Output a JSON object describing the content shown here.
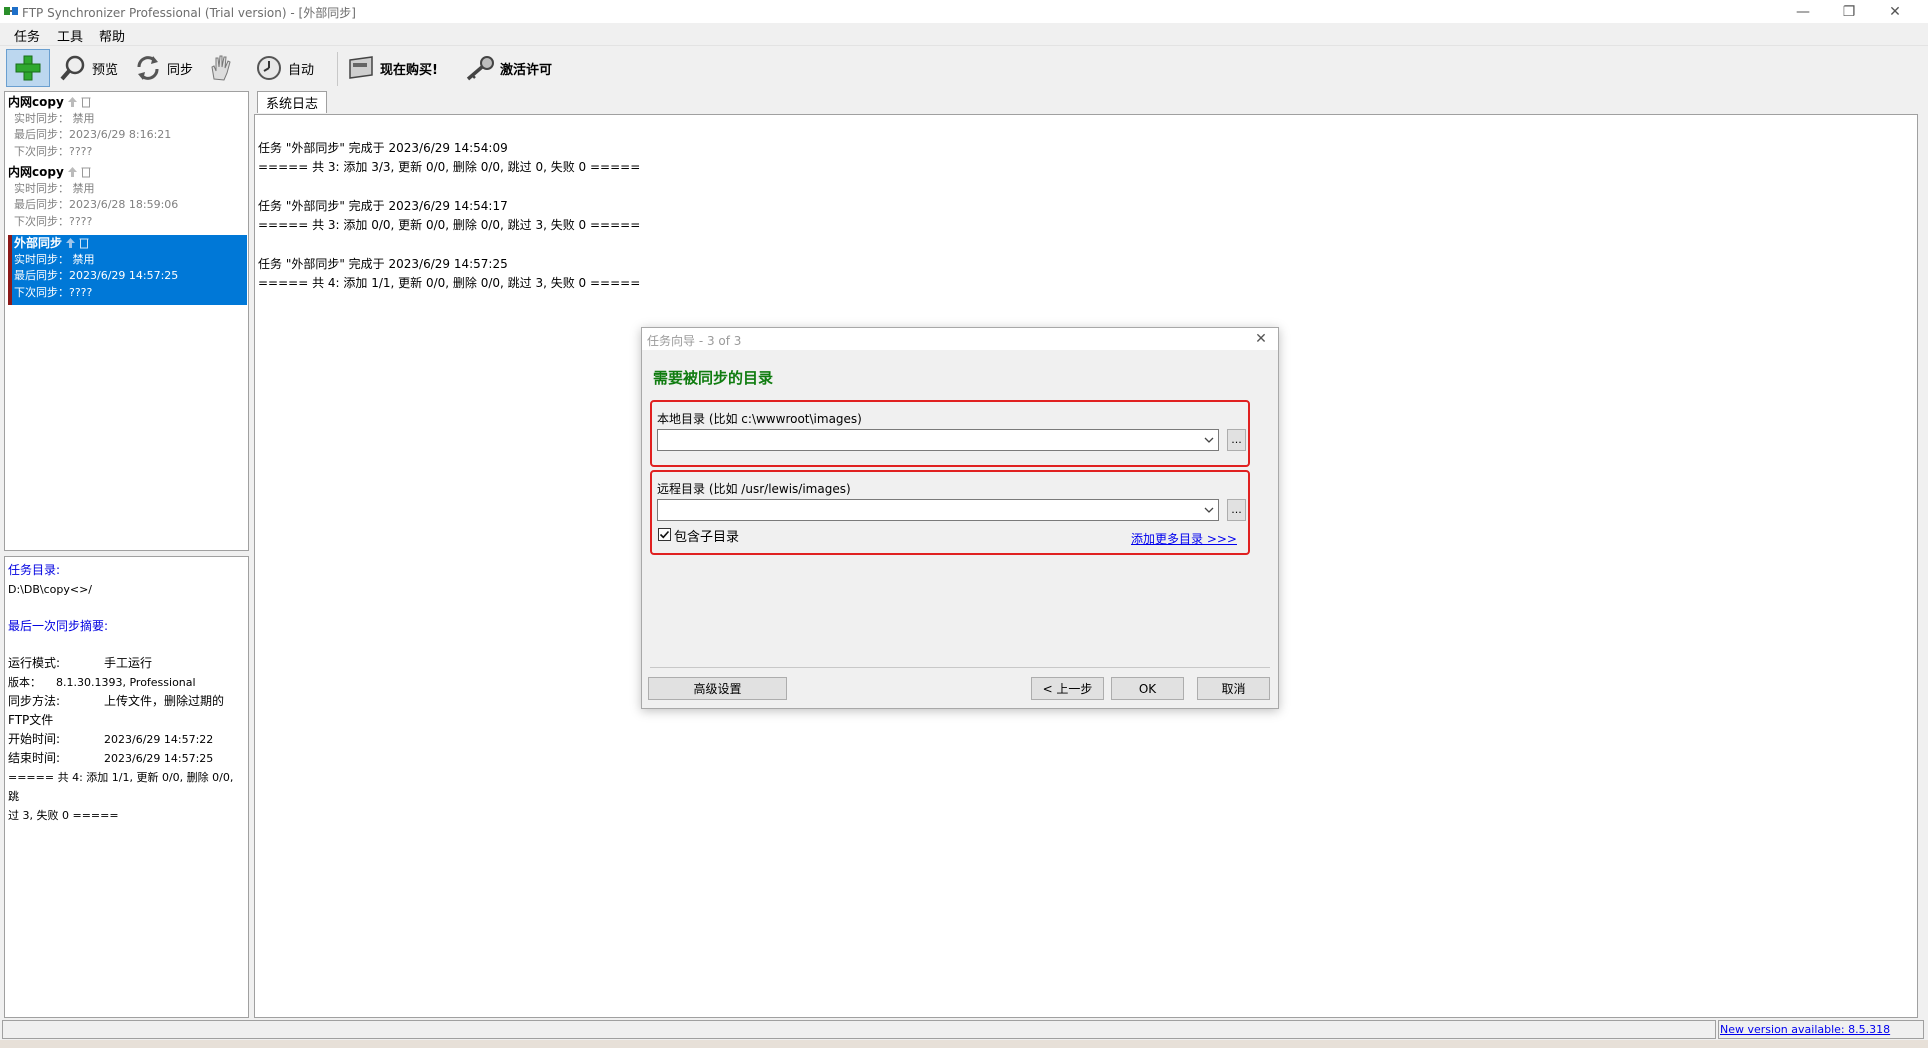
{
  "window": {
    "title": "FTP Synchronizer Professional (Trial version) - [外部同步]",
    "min_glyph": "—",
    "max_glyph": "❐",
    "close_glyph": "✕"
  },
  "menu": {
    "task": "任务",
    "tools": "工具",
    "help": "帮助"
  },
  "toolbar": {
    "preview": "预览",
    "sync": "同步",
    "auto": "自动",
    "buy": "现在购买!",
    "activate": "激活许可"
  },
  "tasks": [
    {
      "name": "内网copy",
      "realtime": "实时同步：  禁用",
      "last": "最后同步：2023/6/29 8:16:21",
      "next": "下次同步：????"
    },
    {
      "name": "内网copy",
      "realtime": "实时同步：  禁用",
      "last": "最后同步：2023/6/28 18:59:06",
      "next": "下次同步：????"
    },
    {
      "name": "外部同步",
      "realtime": "实时同步：  禁用",
      "last": "最后同步：2023/6/29 14:57:25",
      "next": "下次同步：????"
    }
  ],
  "info": {
    "task_dir_label": "任务目录:",
    "task_dir_value": "D:\\DB\\copy<>/",
    "summary_label": "最后一次同步摘要:",
    "mode_key": "运行模式:",
    "mode_val": "手工运行",
    "version_key": "版本：",
    "version_val": "8.1.30.1393, Professional",
    "method_key": "同步方法:",
    "method_val": "上传文件，删除过期的",
    "method_val2": "FTP文件",
    "start_key": "开始时间:",
    "start_val": "2023/6/29 14:57:22",
    "end_key": "结束时间:",
    "end_val": "2023/6/29 14:57:25",
    "result1": "===== 共 4: 添加 1/1, 更新 0/0, 删除 0/0, 跳",
    "result2": "过 3, 失败 0 ====="
  },
  "log": {
    "tab": "系统日志",
    "lines": [
      "任务 \"外部同步\" 完成于 2023/6/29 14:54:09",
      "===== 共 3: 添加 3/3, 更新 0/0, 删除 0/0, 跳过 0, 失败 0 =====",
      "任务 \"外部同步\" 完成于 2023/6/29 14:54:17",
      "===== 共 3: 添加 0/0, 更新 0/0, 删除 0/0, 跳过 3, 失败 0 =====",
      "任务 \"外部同步\" 完成于 2023/6/29 14:57:25",
      "===== 共 4: 添加 1/1, 更新 0/0, 删除 0/0, 跳过 3, 失败 0 ====="
    ]
  },
  "dialog": {
    "title": "任务向导 - 3 of 3",
    "close_glyph": "✕",
    "heading": "需要被同步的目录",
    "local_label": "本地目录 (比如 c:\\wwwroot\\images)",
    "local_value": "",
    "remote_label": "远程目录 (比如 /usr/lewis/images)",
    "remote_value": "",
    "browse": "...",
    "include_sub": "包含子目录",
    "include_sub_checked": true,
    "add_more": "添加更多目录 >>>",
    "advanced": "高级设置",
    "prev": "< 上一步",
    "ok": "OK",
    "cancel": "取消"
  },
  "status": {
    "update_link": "New version available: 8.5.318"
  }
}
